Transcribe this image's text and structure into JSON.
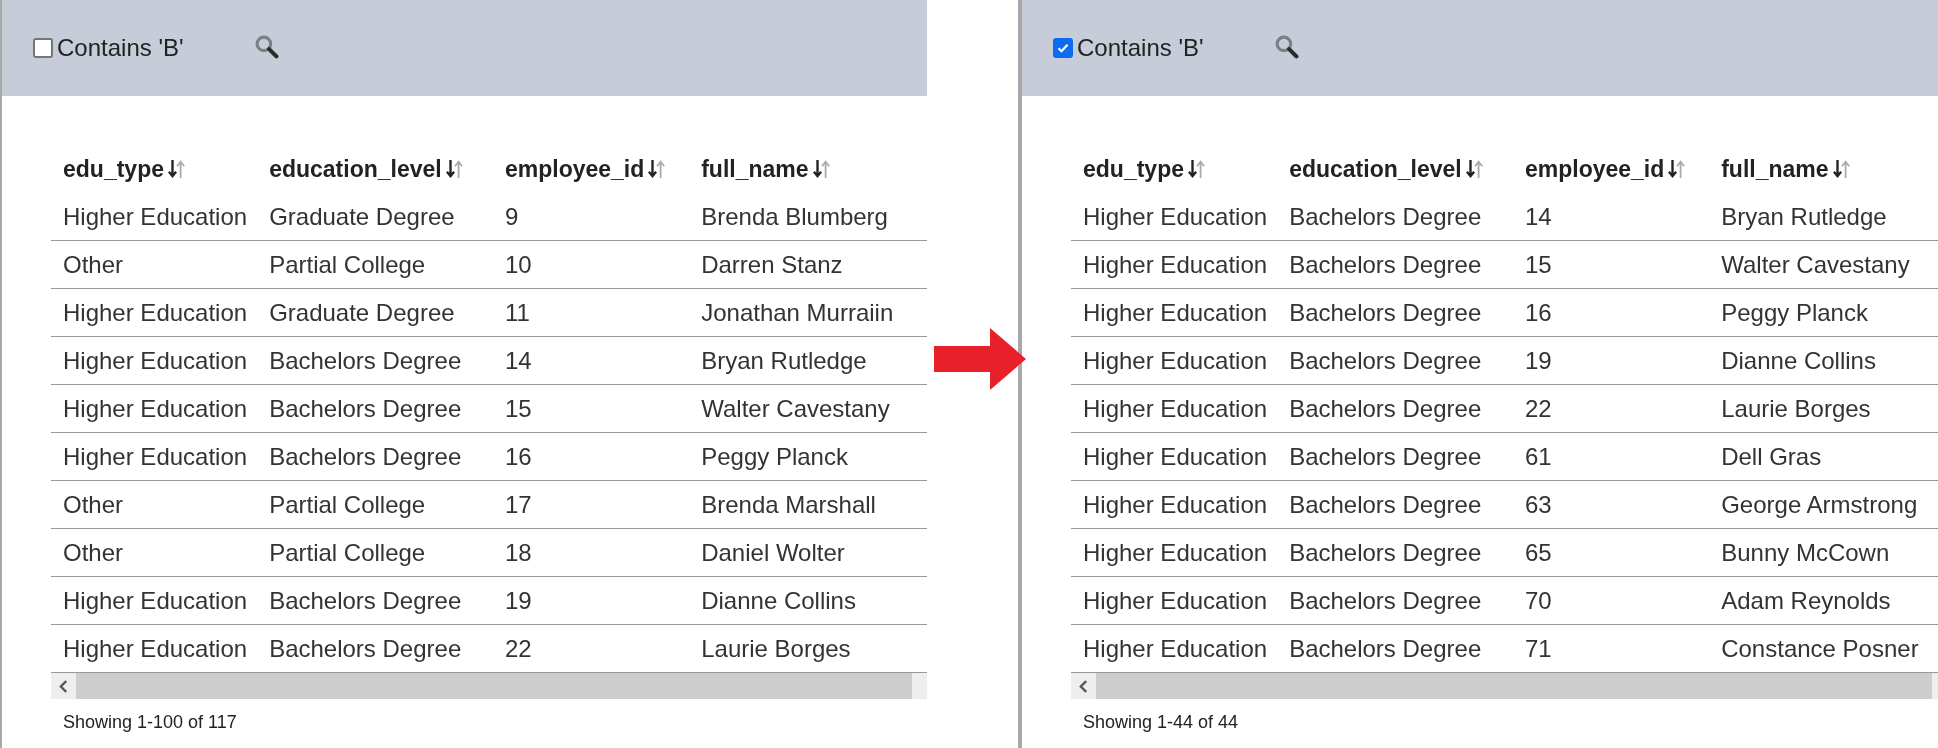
{
  "panels": [
    {
      "filter": {
        "label": "Contains 'B'",
        "checked": false
      },
      "columns": [
        "edu_type",
        "education_level",
        "employee_id",
        "full_name"
      ],
      "rows": [
        [
          "Higher Education",
          "Graduate Degree",
          "9",
          "Brenda Blumberg"
        ],
        [
          "Other",
          "Partial College",
          "10",
          "Darren Stanz"
        ],
        [
          "Higher Education",
          "Graduate Degree",
          "11",
          "Jonathan Murraiin"
        ],
        [
          "Higher Education",
          "Bachelors Degree",
          "14",
          "Bryan Rutledge"
        ],
        [
          "Higher Education",
          "Bachelors Degree",
          "15",
          "Walter Cavestany"
        ],
        [
          "Higher Education",
          "Bachelors Degree",
          "16",
          "Peggy Planck"
        ],
        [
          "Other",
          "Partial College",
          "17",
          "Brenda Marshall"
        ],
        [
          "Other",
          "Partial College",
          "18",
          "Daniel Wolter"
        ],
        [
          "Higher Education",
          "Bachelors Degree",
          "19",
          "Dianne Collins"
        ],
        [
          "Higher Education",
          "Bachelors Degree",
          "22",
          "Laurie Borges"
        ]
      ],
      "footer": "Showing 1-100 of 117"
    },
    {
      "filter": {
        "label": "Contains 'B'",
        "checked": true
      },
      "columns": [
        "edu_type",
        "education_level",
        "employee_id",
        "full_name"
      ],
      "rows": [
        [
          "Higher Education",
          "Bachelors Degree",
          "14",
          "Bryan Rutledge"
        ],
        [
          "Higher Education",
          "Bachelors Degree",
          "15",
          "Walter Cavestany"
        ],
        [
          "Higher Education",
          "Bachelors Degree",
          "16",
          "Peggy Planck"
        ],
        [
          "Higher Education",
          "Bachelors Degree",
          "19",
          "Dianne Collins"
        ],
        [
          "Higher Education",
          "Bachelors Degree",
          "22",
          "Laurie Borges"
        ],
        [
          "Higher Education",
          "Bachelors Degree",
          "61",
          "Dell Gras"
        ],
        [
          "Higher Education",
          "Bachelors Degree",
          "63",
          "George Armstrong"
        ],
        [
          "Higher Education",
          "Bachelors Degree",
          "65",
          "Bunny McCown"
        ],
        [
          "Higher Education",
          "Bachelors Degree",
          "70",
          "Adam Reynolds"
        ],
        [
          "Higher Education",
          "Bachelors Degree",
          "71",
          "Constance Posner"
        ]
      ],
      "footer": "Showing 1-44 of 44"
    }
  ]
}
